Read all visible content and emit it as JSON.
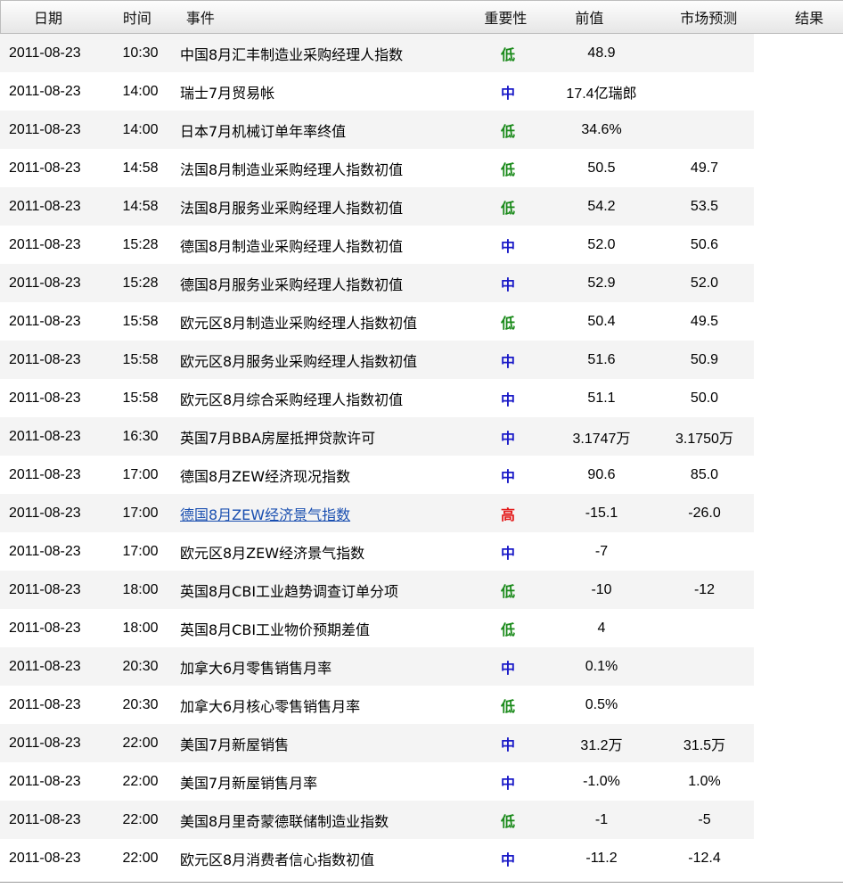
{
  "header": {
    "date": "日期",
    "time": "时间",
    "event": "事件",
    "importance": "重要性",
    "previous": "前值",
    "forecast": "市场预测",
    "result": "结果"
  },
  "colors": {
    "low": "#1a8a1a",
    "mid": "#1a1ac8",
    "high": "#e31a1a",
    "link": "#1a4fb0"
  },
  "rows": [
    {
      "date": "2011-08-23",
      "time": "10:30",
      "event": "中国8月汇丰制造业采购经理人指数",
      "importance": "低",
      "level": "low",
      "previous": "48.9",
      "forecast": "",
      "link": false
    },
    {
      "date": "2011-08-23",
      "time": "14:00",
      "event": "瑞士7月贸易帐",
      "importance": "中",
      "level": "mid",
      "previous": "17.4亿瑞郎",
      "forecast": "",
      "link": false
    },
    {
      "date": "2011-08-23",
      "time": "14:00",
      "event": "日本7月机械订单年率终值",
      "importance": "低",
      "level": "low",
      "previous": "34.6%",
      "forecast": "",
      "link": false
    },
    {
      "date": "2011-08-23",
      "time": "14:58",
      "event": "法国8月制造业采购经理人指数初值",
      "importance": "低",
      "level": "low",
      "previous": "50.5",
      "forecast": "49.7",
      "link": false
    },
    {
      "date": "2011-08-23",
      "time": "14:58",
      "event": "法国8月服务业采购经理人指数初值",
      "importance": "低",
      "level": "low",
      "previous": "54.2",
      "forecast": "53.5",
      "link": false
    },
    {
      "date": "2011-08-23",
      "time": "15:28",
      "event": "德国8月制造业采购经理人指数初值",
      "importance": "中",
      "level": "mid",
      "previous": "52.0",
      "forecast": "50.6",
      "link": false
    },
    {
      "date": "2011-08-23",
      "time": "15:28",
      "event": "德国8月服务业采购经理人指数初值",
      "importance": "中",
      "level": "mid",
      "previous": "52.9",
      "forecast": "52.0",
      "link": false
    },
    {
      "date": "2011-08-23",
      "time": "15:58",
      "event": "欧元区8月制造业采购经理人指数初值",
      "importance": "低",
      "level": "low",
      "previous": "50.4",
      "forecast": "49.5",
      "link": false
    },
    {
      "date": "2011-08-23",
      "time": "15:58",
      "event": "欧元区8月服务业采购经理人指数初值",
      "importance": "中",
      "level": "mid",
      "previous": "51.6",
      "forecast": "50.9",
      "link": false
    },
    {
      "date": "2011-08-23",
      "time": "15:58",
      "event": "欧元区8月综合采购经理人指数初值",
      "importance": "中",
      "level": "mid",
      "previous": "51.1",
      "forecast": "50.0",
      "link": false
    },
    {
      "date": "2011-08-23",
      "time": "16:30",
      "event": "英国7月BBA房屋抵押贷款许可",
      "importance": "中",
      "level": "mid",
      "previous": "3.1747万",
      "forecast": "3.1750万",
      "link": false
    },
    {
      "date": "2011-08-23",
      "time": "17:00",
      "event": "德国8月ZEW经济现况指数",
      "importance": "中",
      "level": "mid",
      "previous": "90.6",
      "forecast": "85.0",
      "link": false
    },
    {
      "date": "2011-08-23",
      "time": "17:00",
      "event": "德国8月ZEW经济景气指数",
      "importance": "高",
      "level": "high",
      "previous": "-15.1",
      "forecast": "-26.0",
      "link": true
    },
    {
      "date": "2011-08-23",
      "time": "17:00",
      "event": "欧元区8月ZEW经济景气指数",
      "importance": "中",
      "level": "mid",
      "previous": "-7",
      "forecast": "",
      "link": false
    },
    {
      "date": "2011-08-23",
      "time": "18:00",
      "event": "英国8月CBI工业趋势调查订单分项",
      "importance": "低",
      "level": "low",
      "previous": "-10",
      "forecast": "-12",
      "link": false
    },
    {
      "date": "2011-08-23",
      "time": "18:00",
      "event": "英国8月CBI工业物价预期差值",
      "importance": "低",
      "level": "low",
      "previous": "4",
      "forecast": "",
      "link": false
    },
    {
      "date": "2011-08-23",
      "time": "20:30",
      "event": "加拿大6月零售销售月率",
      "importance": "中",
      "level": "mid",
      "previous": "0.1%",
      "forecast": "",
      "link": false
    },
    {
      "date": "2011-08-23",
      "time": "20:30",
      "event": "加拿大6月核心零售销售月率",
      "importance": "低",
      "level": "low",
      "previous": "0.5%",
      "forecast": "",
      "link": false
    },
    {
      "date": "2011-08-23",
      "time": "22:00",
      "event": "美国7月新屋销售",
      "importance": "中",
      "level": "mid",
      "previous": "31.2万",
      "forecast": "31.5万",
      "link": false
    },
    {
      "date": "2011-08-23",
      "time": "22:00",
      "event": "美国7月新屋销售月率",
      "importance": "中",
      "level": "mid",
      "previous": "-1.0%",
      "forecast": "1.0%",
      "link": false
    },
    {
      "date": "2011-08-23",
      "time": "22:00",
      "event": "美国8月里奇蒙德联储制造业指数",
      "importance": "低",
      "level": "low",
      "previous": "-1",
      "forecast": "-5",
      "link": false
    },
    {
      "date": "2011-08-23",
      "time": "22:00",
      "event": "欧元区8月消费者信心指数初值",
      "importance": "中",
      "level": "mid",
      "previous": "-11.2",
      "forecast": "-12.4",
      "link": false
    }
  ]
}
